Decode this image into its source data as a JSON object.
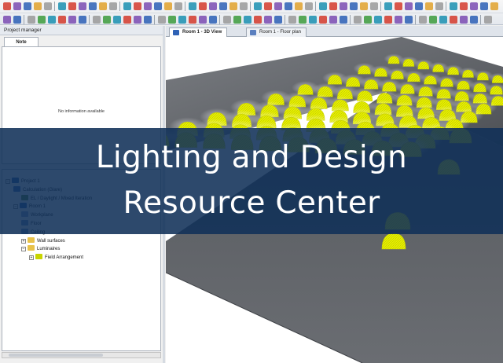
{
  "panel": {
    "title": "Project manager",
    "tab_label": "Note",
    "empty_message": "No information available"
  },
  "tree": [
    {
      "id": "project",
      "label": "Project 1",
      "depth": 0,
      "expander": "−",
      "icon": "project-icon",
      "color": "#2f62b6"
    },
    {
      "id": "calc",
      "label": "Calculation (Glare)",
      "depth": 1,
      "expander": "",
      "icon": "calculation-icon",
      "color": "#3a6fbe"
    },
    {
      "id": "calc-sub",
      "label": "EL / Daylight / Mixed Iteration",
      "depth": 2,
      "expander": "",
      "icon": "check-icon",
      "color": "#5a8a3a"
    },
    {
      "id": "room",
      "label": "Room 1",
      "depth": 1,
      "expander": "−",
      "icon": "room-icon",
      "color": "#2f62b6"
    },
    {
      "id": "workplane",
      "label": "Workplane",
      "depth": 2,
      "expander": "",
      "icon": "workplane-icon",
      "color": "#8aa6d6"
    },
    {
      "id": "floor",
      "label": "Floor",
      "depth": 2,
      "expander": "",
      "icon": "floor-icon",
      "color": "#6f90c8"
    },
    {
      "id": "ceiling",
      "label": "Ceiling",
      "depth": 2,
      "expander": "",
      "icon": "ceiling-icon",
      "color": "#6f90c8"
    },
    {
      "id": "walls",
      "label": "Wall surfaces",
      "depth": 2,
      "expander": "+",
      "icon": "folder-icon",
      "color": "#e8c24a"
    },
    {
      "id": "luminaires",
      "label": "Luminaires",
      "depth": 2,
      "expander": "−",
      "icon": "folder-icon",
      "color": "#e8c24a"
    },
    {
      "id": "field",
      "label": "Field Arrangement",
      "depth": 3,
      "expander": "+",
      "icon": "luminaire-arrangement-icon",
      "color": "#c8d400"
    }
  ],
  "view_tabs": [
    {
      "label": "Room 1 - 3D View",
      "active": true,
      "icon": "3d-view-icon",
      "color": "#2f62b6"
    },
    {
      "label": "Room 1 - Floor plan",
      "active": false,
      "icon": "floor-plan-icon",
      "color": "#5a7fbf"
    }
  ],
  "banner": {
    "line1": "Lighting and Design",
    "line2": "Resource Center",
    "background": "#103058"
  },
  "colors": {
    "luminaire": "#e8f000",
    "room_surface": "#5a5d62",
    "room_surface_light": "#8c8f94",
    "toolbar_icons": [
      "#2b5fb5",
      "#d33a2c",
      "#3c9b3c",
      "#e0a12b",
      "#7a4bb2",
      "#1a8fb0",
      "#999999"
    ]
  }
}
